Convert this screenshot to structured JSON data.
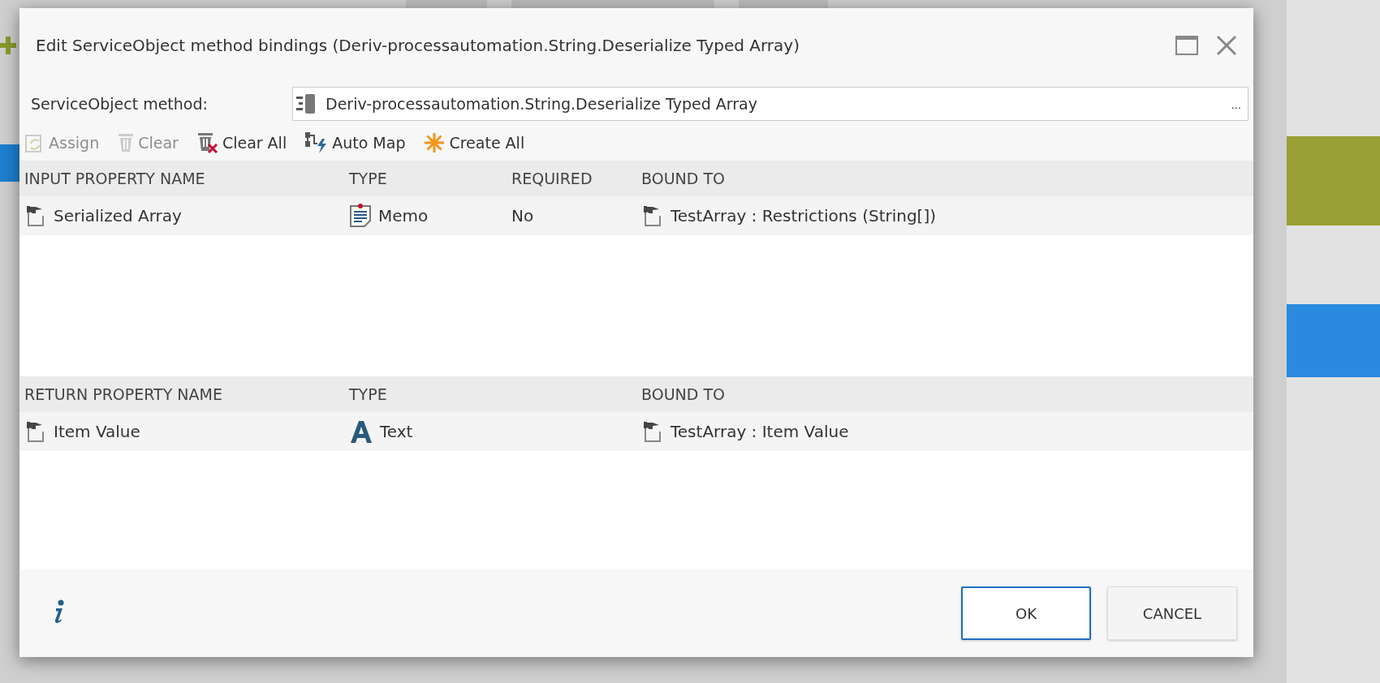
{
  "dialog": {
    "title": "Edit ServiceObject method bindings (Deriv-processautomation.String.Deserialize Typed Array)",
    "method_label": "ServiceObject method:",
    "method_value": "Deriv-processautomation.String.Deserialize Typed Array",
    "method_browse": "...",
    "toolbar": [
      {
        "kind": "assign",
        "label": "Assign",
        "disabled": true
      },
      {
        "kind": "clear",
        "label": "Clear",
        "disabled": true
      },
      {
        "kind": "clear_all",
        "label": "Clear All",
        "disabled": false
      },
      {
        "kind": "auto_map",
        "label": "Auto Map",
        "disabled": false
      },
      {
        "kind": "create_all",
        "label": "Create All",
        "disabled": false
      }
    ],
    "input_table": {
      "columns": [
        "INPUT PROPERTY NAME",
        "TYPE",
        "REQUIRED",
        "BOUND TO"
      ],
      "rows": [
        {
          "name": "Serialized Array",
          "kind": "memo",
          "type": "Memo",
          "required": "No",
          "bound_to": "TestArray : Restrictions (String[])"
        }
      ]
    },
    "return_table": {
      "columns": [
        "RETURN PROPERTY NAME",
        "TYPE",
        "BOUND TO"
      ],
      "rows": [
        {
          "name": "Item Value",
          "kind": "text",
          "type": "Text",
          "bound_to": "TestArray : Item Value"
        }
      ]
    },
    "buttons": [
      {
        "label": "OK",
        "selected": true
      },
      {
        "label": "CANCEL",
        "selected": false
      }
    ]
  }
}
